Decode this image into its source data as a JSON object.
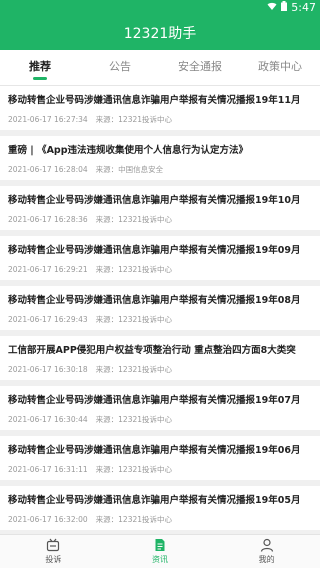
{
  "status": {
    "time": "5:47"
  },
  "app": {
    "title": "12321助手"
  },
  "tabs": [
    {
      "label": "推荐",
      "active": true
    },
    {
      "label": "公告",
      "active": false
    },
    {
      "label": "安全通报",
      "active": false
    },
    {
      "label": "政策中心",
      "active": false
    }
  ],
  "items": [
    {
      "title": "移动转售企业号码涉嫌通讯信息诈骗用户举报有关情况播报19年11月",
      "date": "2021-06-17 16:27:34",
      "source": "来源：12321投诉中心"
    },
    {
      "title": "重磅 | 《App违法违规收集使用个人信息行为认定方法》",
      "date": "2021-06-17 16:28:04",
      "source": "来源：中国信息安全"
    },
    {
      "title": "移动转售企业号码涉嫌通讯信息诈骗用户举报有关情况播报19年10月",
      "date": "2021-06-17 16:28:36",
      "source": "来源：12321投诉中心"
    },
    {
      "title": "移动转售企业号码涉嫌通讯信息诈骗用户举报有关情况播报19年09月",
      "date": "2021-06-17 16:29:21",
      "source": "来源：12321投诉中心"
    },
    {
      "title": "移动转售企业号码涉嫌通讯信息诈骗用户举报有关情况播报19年08月",
      "date": "2021-06-17 16:29:43",
      "source": "来源：12321投诉中心"
    },
    {
      "title": "工信部开展APP侵犯用户权益专项整治行动 重点整治四方面8大类突",
      "date": "2021-06-17 16:30:18",
      "source": "来源：12321投诉中心"
    },
    {
      "title": "移动转售企业号码涉嫌通讯信息诈骗用户举报有关情况播报19年07月",
      "date": "2021-06-17 16:30:44",
      "source": "来源：12321投诉中心"
    },
    {
      "title": "移动转售企业号码涉嫌通讯信息诈骗用户举报有关情况播报19年06月",
      "date": "2021-06-17 16:31:11",
      "source": "来源：12321投诉中心"
    },
    {
      "title": "移动转售企业号码涉嫌通讯信息诈骗用户举报有关情况播报19年05月",
      "date": "2021-06-17 16:32:00",
      "source": "来源：12321投诉中心"
    }
  ],
  "nav": [
    {
      "label": "投诉",
      "icon": "complaint-icon",
      "active": false
    },
    {
      "label": "资讯",
      "icon": "news-icon",
      "active": true
    },
    {
      "label": "我的",
      "icon": "profile-icon",
      "active": false
    }
  ],
  "colors": {
    "brand": "#1fb466"
  }
}
